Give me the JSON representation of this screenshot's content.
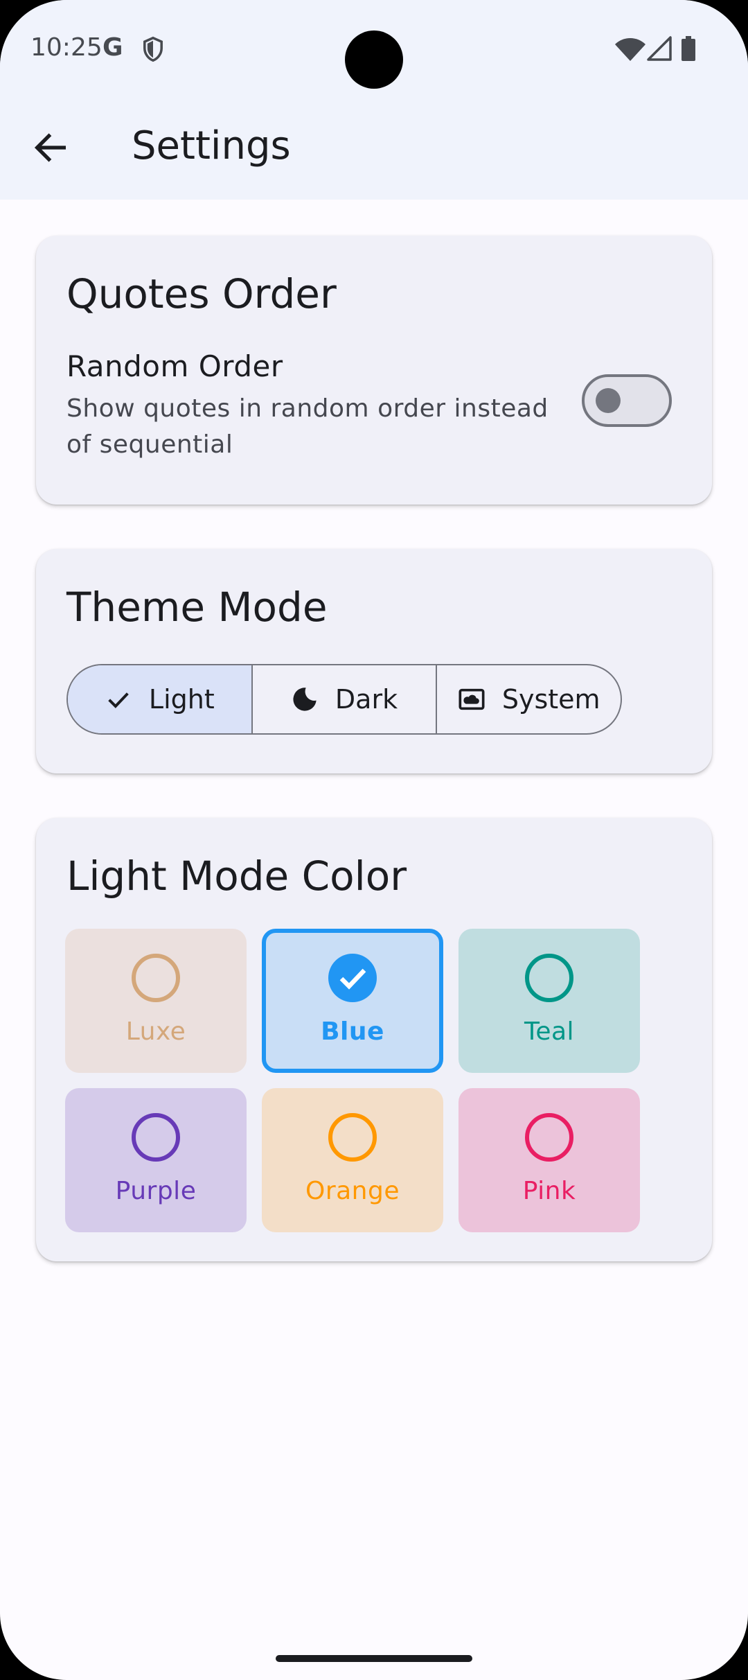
{
  "status_bar": {
    "time": "10:25",
    "g_letter": "G"
  },
  "app_bar": {
    "title": "Settings"
  },
  "quotes_order": {
    "title": "Quotes Order",
    "random_order_title": "Random Order",
    "random_order_description": "Show quotes in random order instead of sequential",
    "random_order_enabled": false
  },
  "theme_mode": {
    "title": "Theme Mode",
    "options": [
      {
        "label": "Light",
        "icon": "check-icon",
        "selected": true
      },
      {
        "label": "Dark",
        "icon": "moon-icon",
        "selected": false
      },
      {
        "label": "System",
        "icon": "system-icon",
        "selected": false
      }
    ]
  },
  "light_mode_color": {
    "title": "Light Mode Color",
    "options": [
      {
        "label": "Luxe",
        "color": "#d4a77a",
        "bg": "#ebe0de",
        "selected": false
      },
      {
        "label": "Blue",
        "color": "#2196f3",
        "bg": "#c9def6",
        "selected": true
      },
      {
        "label": "Teal",
        "color": "#009688",
        "bg": "#c0dde0",
        "selected": false
      },
      {
        "label": "Purple",
        "color": "#673ab7",
        "bg": "#d5cbea",
        "selected": false
      },
      {
        "label": "Orange",
        "color": "#ff9800",
        "bg": "#f3dec8",
        "selected": false
      },
      {
        "label": "Pink",
        "color": "#e91e63",
        "bg": "#ecc3da",
        "selected": false
      }
    ]
  }
}
